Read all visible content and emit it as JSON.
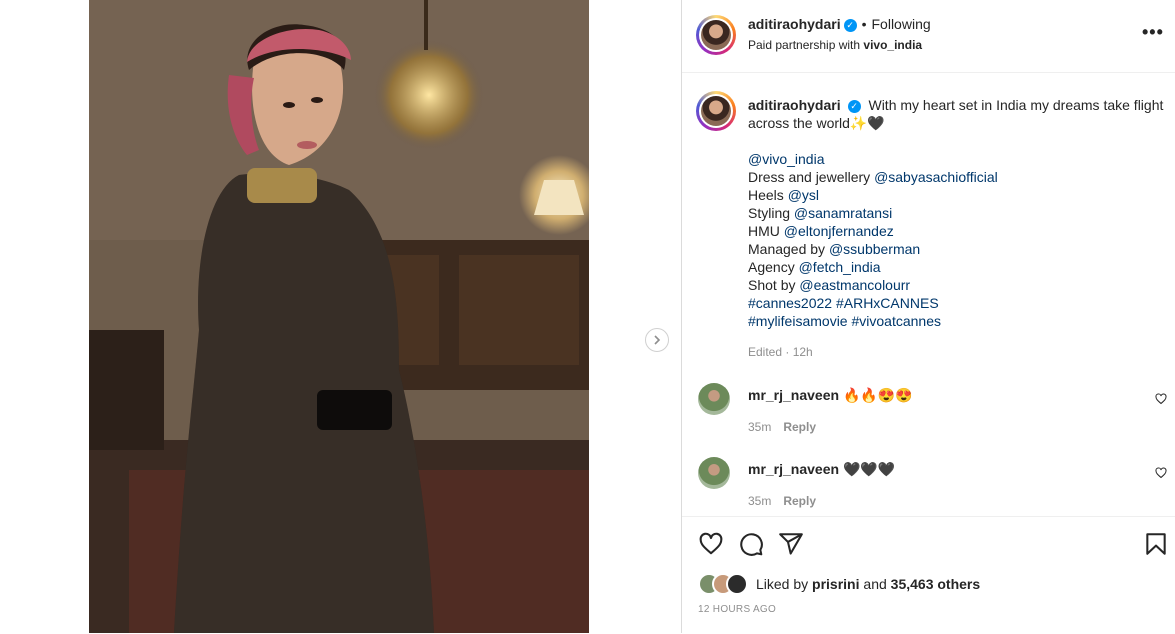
{
  "post": {
    "username": "aditiraohydari",
    "follow_status": "Following",
    "partner_prefix": "Paid partnership with",
    "partner_name": "vivo_india",
    "more_label": "•••",
    "image_alt": "Photo of a woman in a black lace dress and a pink headscarf"
  },
  "caption": {
    "username": "aditiraohydari",
    "text": "With my heart set in India my dreams take flight across the world✨🖤",
    "lines": [
      {
        "prefix": "",
        "link": "@vivo_india"
      },
      {
        "prefix": "Dress and jewellery ",
        "link": "@sabyasachiofficial"
      },
      {
        "prefix": "Heels ",
        "link": "@ysl"
      },
      {
        "prefix": "Styling ",
        "link": "@sanamratansi"
      },
      {
        "prefix": "HMU ",
        "link": "@eltonjfernandez"
      },
      {
        "prefix": "Managed by ",
        "link": "@ssubberman"
      },
      {
        "prefix": "Agency ",
        "link": "@fetch_india"
      },
      {
        "prefix": "Shot by ",
        "link": "@eastmancolourr"
      },
      {
        "prefix": "",
        "link": "#cannes2022 #ARHxCANNES"
      },
      {
        "prefix": "",
        "link": "#mylifeisamovie #vivoatcannes"
      }
    ],
    "edited": "Edited · 12h"
  },
  "comments": [
    {
      "username": "mr_rj_naveen",
      "text": "🔥🔥😍😍",
      "time": "35m",
      "reply": "Reply"
    },
    {
      "username": "mr_rj_naveen",
      "text": "🖤🖤🖤",
      "time": "35m",
      "reply": "Reply"
    }
  ],
  "likes": {
    "prefix": "Liked by",
    "name": "prisrini",
    "middle": "and",
    "count": "35,463 others"
  },
  "timestamp": "12 HOURS AGO",
  "icons": [
    "verified-badge",
    "more-options-icon",
    "next-arrow-icon",
    "heart-icon",
    "comment-icon",
    "share-icon",
    "bookmark-icon"
  ],
  "colors": {
    "link": "#00376b",
    "verified": "#0095f6",
    "muted": "#8e8e8e"
  }
}
